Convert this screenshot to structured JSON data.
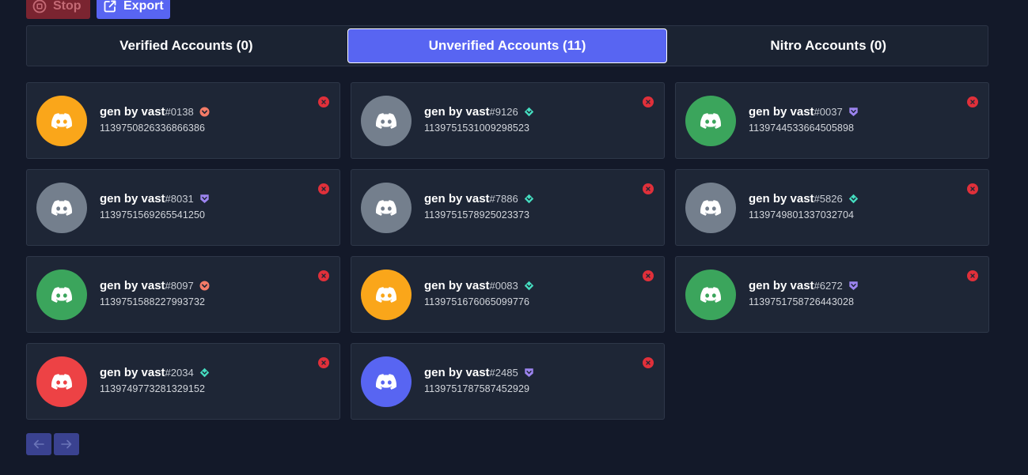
{
  "toolbar": {
    "stop_label": "Stop",
    "export_label": "Export"
  },
  "tabs": [
    {
      "label": "Verified Accounts (0)",
      "active": false
    },
    {
      "label": "Unverified Accounts (11)",
      "active": true
    },
    {
      "label": "Nitro Accounts (0)",
      "active": false
    }
  ],
  "accounts": [
    {
      "username": "gen by vast",
      "discriminator": "#0138",
      "id": "1139750826336866386",
      "avatar_color": "#faa61a",
      "badge": "hypesquad-brilliance",
      "badge_color": "#f47b67"
    },
    {
      "username": "gen by vast",
      "discriminator": "#9126",
      "id": "1139751531009298523",
      "avatar_color": "#747f8d",
      "badge": "hypesquad-balance",
      "badge_color": "#45ddc0"
    },
    {
      "username": "gen by vast",
      "discriminator": "#0037",
      "id": "1139744533664505898",
      "avatar_color": "#3ba55c",
      "badge": "hypesquad-bravery",
      "badge_color": "#9c84ef"
    },
    {
      "username": "gen by vast",
      "discriminator": "#8031",
      "id": "1139751569265541250",
      "avatar_color": "#747f8d",
      "badge": "hypesquad-bravery",
      "badge_color": "#9c84ef"
    },
    {
      "username": "gen by vast",
      "discriminator": "#7886",
      "id": "1139751578925023373",
      "avatar_color": "#747f8d",
      "badge": "hypesquad-balance",
      "badge_color": "#45ddc0"
    },
    {
      "username": "gen by vast",
      "discriminator": "#5826",
      "id": "1139749801337032704",
      "avatar_color": "#747f8d",
      "badge": "hypesquad-balance",
      "badge_color": "#45ddc0"
    },
    {
      "username": "gen by vast",
      "discriminator": "#8097",
      "id": "1139751588227993732",
      "avatar_color": "#3ba55c",
      "badge": "hypesquad-brilliance",
      "badge_color": "#f47b67"
    },
    {
      "username": "gen by vast",
      "discriminator": "#0083",
      "id": "1139751676065099776",
      "avatar_color": "#faa61a",
      "badge": "hypesquad-balance",
      "badge_color": "#45ddc0"
    },
    {
      "username": "gen by vast",
      "discriminator": "#6272",
      "id": "1139751758726443028",
      "avatar_color": "#3ba55c",
      "badge": "hypesquad-bravery",
      "badge_color": "#9c84ef"
    },
    {
      "username": "gen by vast",
      "discriminator": "#2034",
      "id": "1139749773281329152",
      "avatar_color": "#ed4245",
      "badge": "hypesquad-balance",
      "badge_color": "#45ddc0"
    },
    {
      "username": "gen by vast",
      "discriminator": "#2485",
      "id": "1139751787587452929",
      "avatar_color": "#5865f2",
      "badge": "hypesquad-bravery",
      "badge_color": "#9c84ef"
    }
  ],
  "pager": {
    "prev_icon": "arrow-left-icon",
    "next_icon": "arrow-right-icon"
  }
}
